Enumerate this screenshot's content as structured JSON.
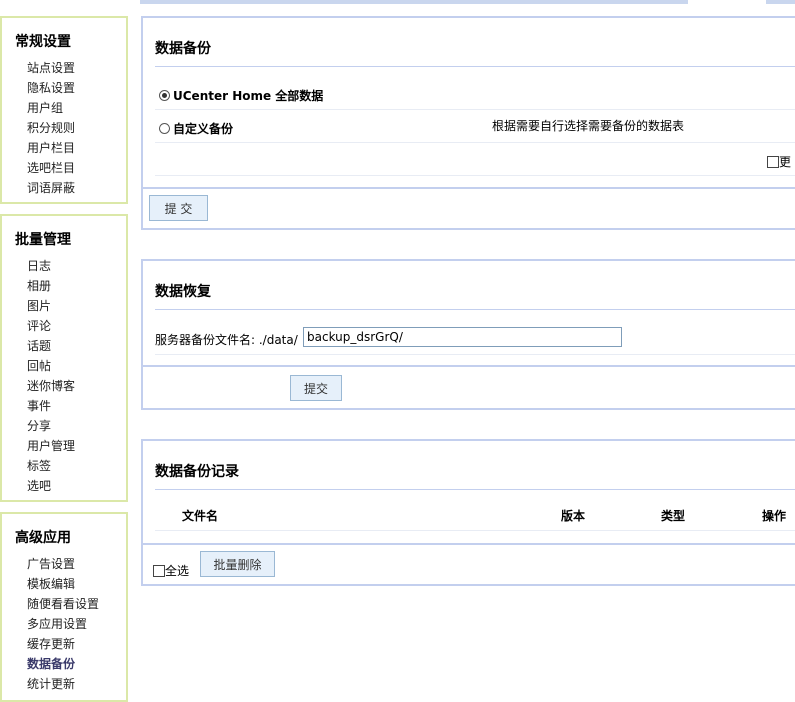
{
  "sidebar": {
    "sections": [
      {
        "title": "常规设置",
        "items": [
          "站点设置",
          "隐私设置",
          "用户组",
          "积分规则",
          "用户栏目",
          "选吧栏目",
          "词语屏蔽"
        ]
      },
      {
        "title": "批量管理",
        "items": [
          "日志",
          "相册",
          "图片",
          "评论",
          "话题",
          "回帖",
          "迷你博客",
          "事件",
          "分享",
          "用户管理",
          "标签",
          "选吧"
        ]
      },
      {
        "title": "高级应用",
        "items": [
          "广告设置",
          "模板编辑",
          "随便看看设置",
          "多应用设置",
          "缓存更新",
          "数据备份",
          "统计更新"
        ]
      }
    ],
    "active_item": "数据备份"
  },
  "backup": {
    "title": "数据备份",
    "option_full": "UCenter Home 全部数据",
    "option_custom": "自定义备份",
    "custom_desc": "根据需要自行选择需要备份的数据表",
    "more_label": "更",
    "submit": "提 交"
  },
  "restore": {
    "title": "数据恢复",
    "label": "服务器备份文件名: ./data/",
    "value": "backup_dsrGrQ/",
    "submit": "提交"
  },
  "records": {
    "title": "数据备份记录",
    "columns": [
      "文件名",
      "版本",
      "类型",
      "操作"
    ],
    "select_all": "全选",
    "batch_delete": "批量删除"
  }
}
